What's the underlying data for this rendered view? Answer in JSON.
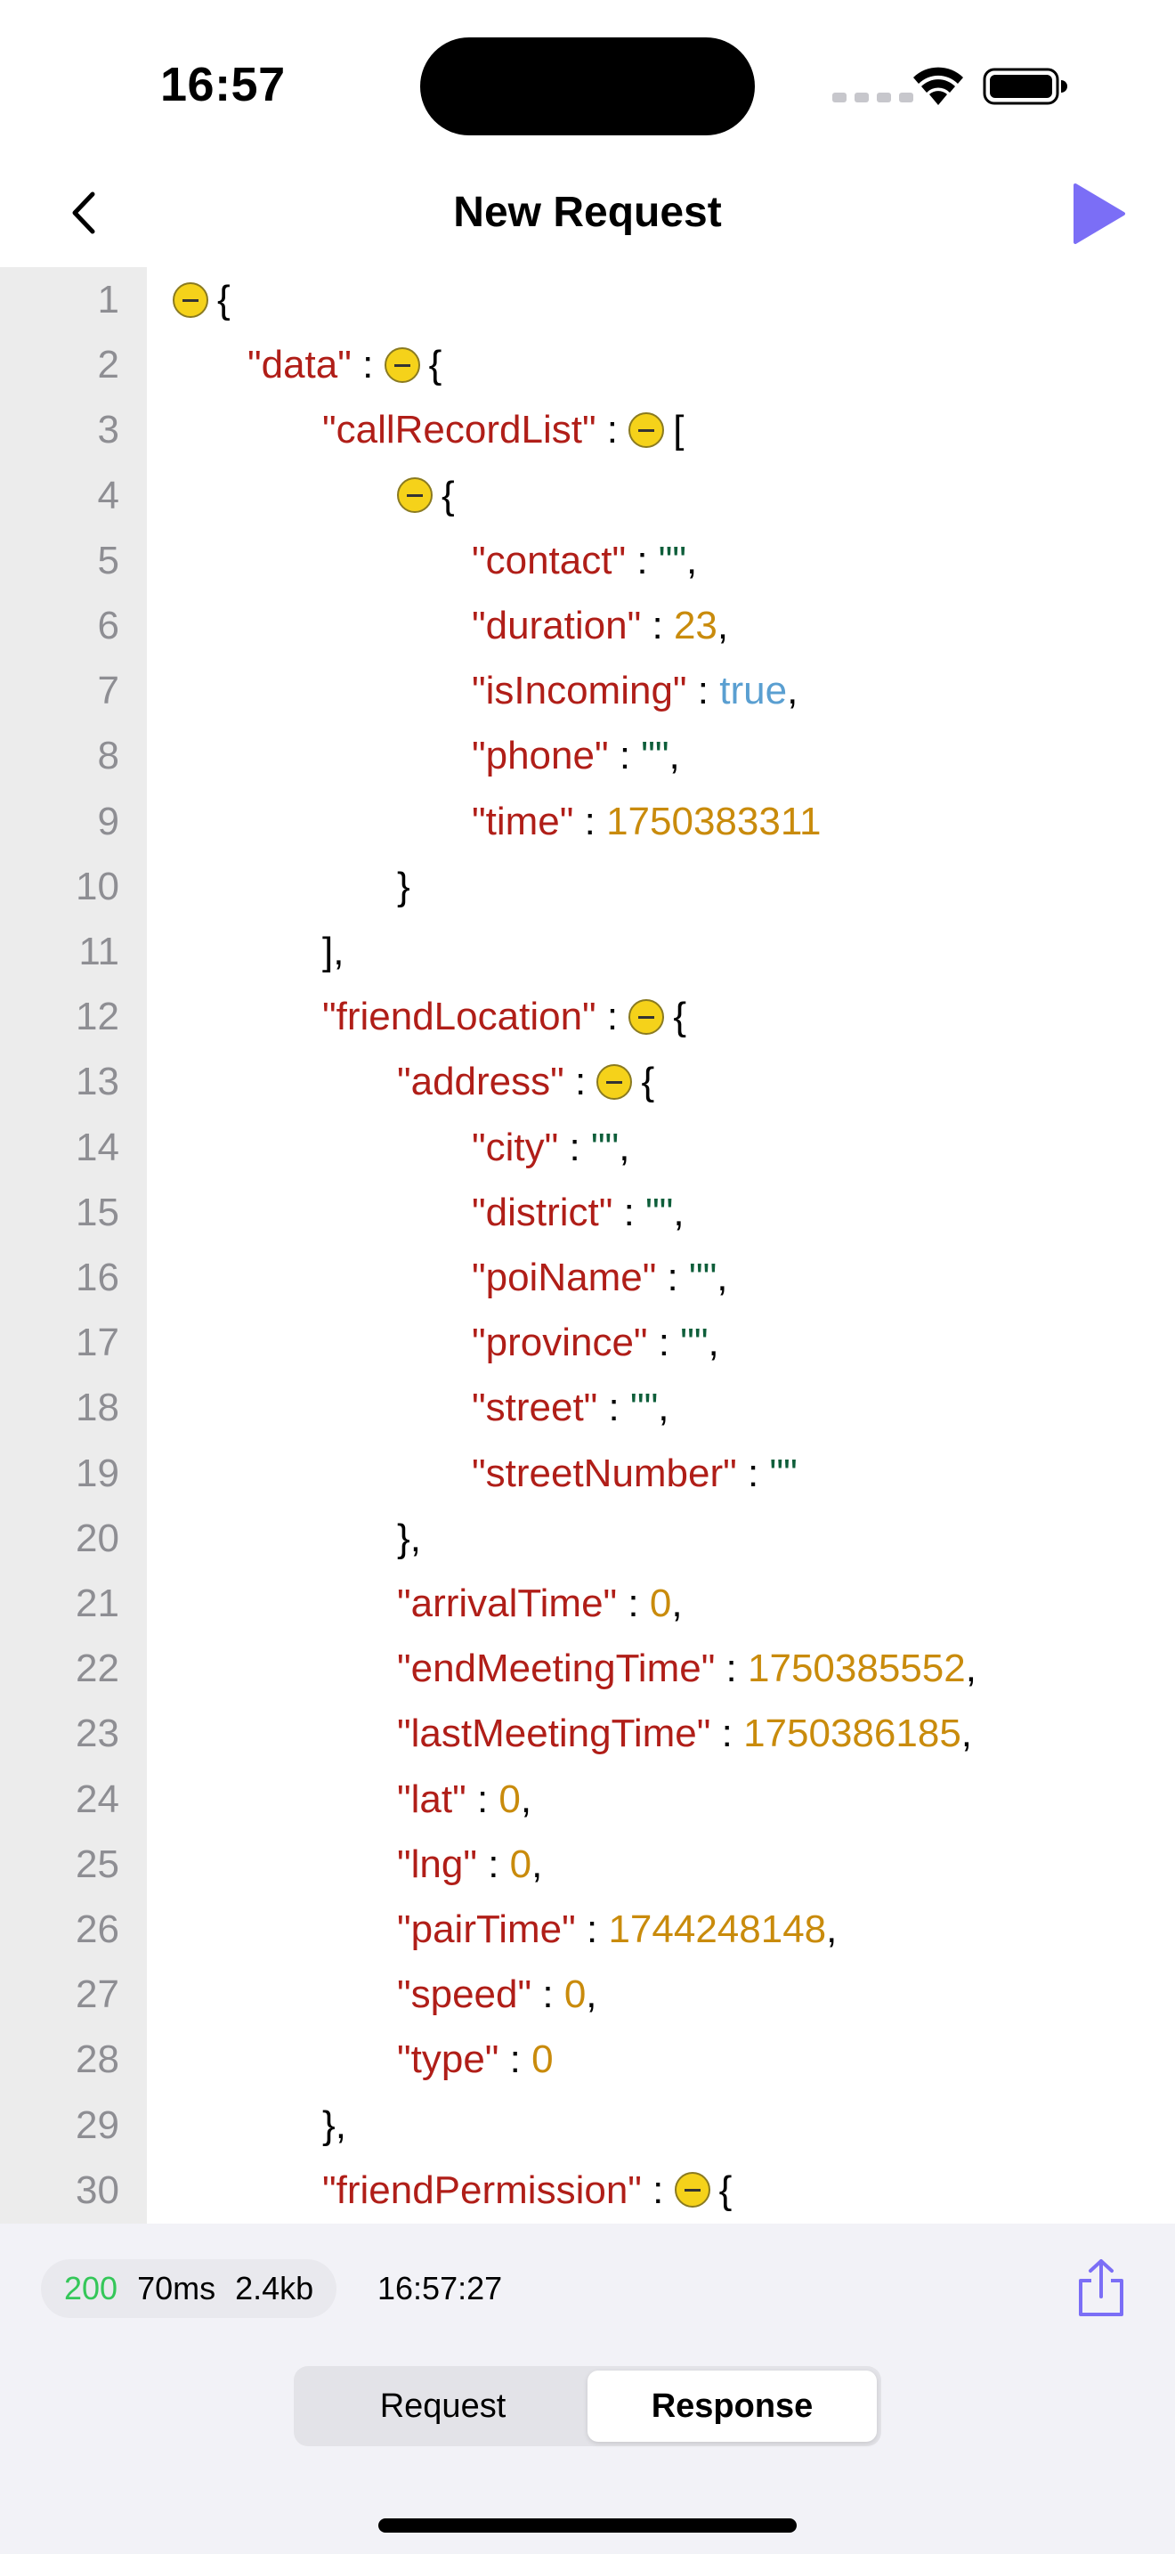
{
  "status_bar": {
    "time": "16:57"
  },
  "nav": {
    "title": "New Request",
    "back_icon": "chevron-left-icon",
    "run_icon": "play-icon"
  },
  "colors": {
    "accent": "#7b6ef6",
    "key": "#b01e18",
    "string": "#0e5e3a",
    "number": "#c98b0c",
    "boolean": "#5a9fd1",
    "status_ok": "#34c759"
  },
  "code_lines": [
    {
      "n": "1",
      "indent": 0,
      "parts": [
        {
          "fold": true
        },
        {
          "t": "{",
          "c": "p"
        }
      ]
    },
    {
      "n": "2",
      "indent": 1,
      "parts": [
        {
          "t": "\"data\"",
          "c": "k"
        },
        {
          "t": " : ",
          "c": "p"
        },
        {
          "fold": true
        },
        {
          "t": "{",
          "c": "p"
        }
      ]
    },
    {
      "n": "3",
      "indent": 2,
      "parts": [
        {
          "t": "\"callRecordList\"",
          "c": "k"
        },
        {
          "t": " : ",
          "c": "p"
        },
        {
          "fold": true
        },
        {
          "t": "[",
          "c": "p"
        }
      ]
    },
    {
      "n": "4",
      "indent": 3,
      "parts": [
        {
          "fold": true
        },
        {
          "t": "{",
          "c": "p"
        }
      ]
    },
    {
      "n": "5",
      "indent": 4,
      "parts": [
        {
          "t": "\"contact\"",
          "c": "k"
        },
        {
          "t": " : ",
          "c": "p"
        },
        {
          "t": "\"\"",
          "c": "s"
        },
        {
          "t": ",",
          "c": "p"
        }
      ]
    },
    {
      "n": "6",
      "indent": 4,
      "parts": [
        {
          "t": "\"duration\"",
          "c": "k"
        },
        {
          "t": " : ",
          "c": "p"
        },
        {
          "t": "23",
          "c": "n"
        },
        {
          "t": ",",
          "c": "p"
        }
      ]
    },
    {
      "n": "7",
      "indent": 4,
      "parts": [
        {
          "t": "\"isIncoming\"",
          "c": "k"
        },
        {
          "t": " : ",
          "c": "p"
        },
        {
          "t": "true",
          "c": "b"
        },
        {
          "t": ",",
          "c": "p"
        }
      ]
    },
    {
      "n": "8",
      "indent": 4,
      "parts": [
        {
          "t": "\"phone\"",
          "c": "k"
        },
        {
          "t": " : ",
          "c": "p"
        },
        {
          "t": "\"\"",
          "c": "s"
        },
        {
          "t": ",",
          "c": "p"
        }
      ]
    },
    {
      "n": "9",
      "indent": 4,
      "parts": [
        {
          "t": "\"time\"",
          "c": "k"
        },
        {
          "t": " : ",
          "c": "p"
        },
        {
          "t": "1750383311",
          "c": "n"
        }
      ]
    },
    {
      "n": "10",
      "indent": 3,
      "parts": [
        {
          "t": "}",
          "c": "p"
        }
      ]
    },
    {
      "n": "11",
      "indent": 2,
      "parts": [
        {
          "t": "],",
          "c": "p"
        }
      ]
    },
    {
      "n": "12",
      "indent": 2,
      "parts": [
        {
          "t": "\"friendLocation\"",
          "c": "k"
        },
        {
          "t": " : ",
          "c": "p"
        },
        {
          "fold": true
        },
        {
          "t": "{",
          "c": "p"
        }
      ]
    },
    {
      "n": "13",
      "indent": 3,
      "parts": [
        {
          "t": "\"address\"",
          "c": "k"
        },
        {
          "t": " : ",
          "c": "p"
        },
        {
          "fold": true
        },
        {
          "t": "{",
          "c": "p"
        }
      ]
    },
    {
      "n": "14",
      "indent": 4,
      "parts": [
        {
          "t": "\"city\"",
          "c": "k"
        },
        {
          "t": " : ",
          "c": "p"
        },
        {
          "t": "\"\"",
          "c": "s"
        },
        {
          "t": ",",
          "c": "p"
        }
      ]
    },
    {
      "n": "15",
      "indent": 4,
      "parts": [
        {
          "t": "\"district\"",
          "c": "k"
        },
        {
          "t": " : ",
          "c": "p"
        },
        {
          "t": "\"\"",
          "c": "s"
        },
        {
          "t": ",",
          "c": "p"
        }
      ]
    },
    {
      "n": "16",
      "indent": 4,
      "parts": [
        {
          "t": "\"poiName\"",
          "c": "k"
        },
        {
          "t": " : ",
          "c": "p"
        },
        {
          "t": "\"\"",
          "c": "s"
        },
        {
          "t": ",",
          "c": "p"
        }
      ]
    },
    {
      "n": "17",
      "indent": 4,
      "parts": [
        {
          "t": "\"province\"",
          "c": "k"
        },
        {
          "t": " : ",
          "c": "p"
        },
        {
          "t": "\"\"",
          "c": "s"
        },
        {
          "t": ",",
          "c": "p"
        }
      ]
    },
    {
      "n": "18",
      "indent": 4,
      "parts": [
        {
          "t": "\"street\"",
          "c": "k"
        },
        {
          "t": " : ",
          "c": "p"
        },
        {
          "t": "\"\"",
          "c": "s"
        },
        {
          "t": ",",
          "c": "p"
        }
      ]
    },
    {
      "n": "19",
      "indent": 4,
      "parts": [
        {
          "t": "\"streetNumber\"",
          "c": "k"
        },
        {
          "t": " : ",
          "c": "p"
        },
        {
          "t": "\"\"",
          "c": "s"
        }
      ]
    },
    {
      "n": "20",
      "indent": 3,
      "parts": [
        {
          "t": "},",
          "c": "p"
        }
      ]
    },
    {
      "n": "21",
      "indent": 3,
      "parts": [
        {
          "t": "\"arrivalTime\"",
          "c": "k"
        },
        {
          "t": " : ",
          "c": "p"
        },
        {
          "t": "0",
          "c": "n"
        },
        {
          "t": ",",
          "c": "p"
        }
      ]
    },
    {
      "n": "22",
      "indent": 3,
      "parts": [
        {
          "t": "\"endMeetingTime\"",
          "c": "k"
        },
        {
          "t": " : ",
          "c": "p"
        },
        {
          "t": "1750385552",
          "c": "n"
        },
        {
          "t": ",",
          "c": "p"
        }
      ]
    },
    {
      "n": "23",
      "indent": 3,
      "parts": [
        {
          "t": "\"lastMeetingTime\"",
          "c": "k"
        },
        {
          "t": " : ",
          "c": "p"
        },
        {
          "t": "1750386185",
          "c": "n"
        },
        {
          "t": ",",
          "c": "p"
        }
      ]
    },
    {
      "n": "24",
      "indent": 3,
      "parts": [
        {
          "t": "\"lat\"",
          "c": "k"
        },
        {
          "t": " : ",
          "c": "p"
        },
        {
          "t": "0",
          "c": "n"
        },
        {
          "t": ",",
          "c": "p"
        }
      ]
    },
    {
      "n": "25",
      "indent": 3,
      "parts": [
        {
          "t": "\"lng\"",
          "c": "k"
        },
        {
          "t": " : ",
          "c": "p"
        },
        {
          "t": "0",
          "c": "n"
        },
        {
          "t": ",",
          "c": "p"
        }
      ]
    },
    {
      "n": "26",
      "indent": 3,
      "parts": [
        {
          "t": "\"pairTime\"",
          "c": "k"
        },
        {
          "t": " : ",
          "c": "p"
        },
        {
          "t": "1744248148",
          "c": "n"
        },
        {
          "t": ",",
          "c": "p"
        }
      ]
    },
    {
      "n": "27",
      "indent": 3,
      "parts": [
        {
          "t": "\"speed\"",
          "c": "k"
        },
        {
          "t": " : ",
          "c": "p"
        },
        {
          "t": "0",
          "c": "n"
        },
        {
          "t": ",",
          "c": "p"
        }
      ]
    },
    {
      "n": "28",
      "indent": 3,
      "parts": [
        {
          "t": "\"type\"",
          "c": "k"
        },
        {
          "t": " : ",
          "c": "p"
        },
        {
          "t": "0",
          "c": "n"
        }
      ]
    },
    {
      "n": "29",
      "indent": 2,
      "parts": [
        {
          "t": "},",
          "c": "p"
        }
      ]
    },
    {
      "n": "30",
      "indent": 2,
      "parts": [
        {
          "t": "\"friendPermission\"",
          "c": "k"
        },
        {
          "t": " : ",
          "c": "p"
        },
        {
          "fold": true
        },
        {
          "t": "{",
          "c": "p"
        }
      ]
    }
  ],
  "response_meta": {
    "status_code": "200",
    "duration": "70ms",
    "size": "2.4kb",
    "timestamp": "16:57:27",
    "share_icon": "share-icon"
  },
  "segmented": {
    "request_label": "Request",
    "response_label": "Response",
    "selected": "Response"
  }
}
